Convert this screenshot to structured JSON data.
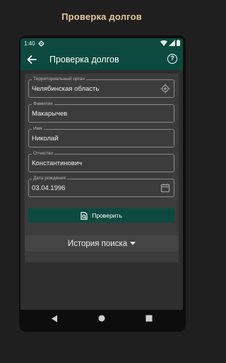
{
  "promo": {
    "title": "Проверка долгов"
  },
  "status_bar": {
    "time": "1:40",
    "icons": [
      "gear-icon",
      "wifi-icon",
      "signal-icon",
      "battery-icon"
    ]
  },
  "app_bar": {
    "title": "Проверка долгов",
    "back_icon": "arrow-back-icon",
    "help_icon": "help-icon",
    "help_glyph": "?"
  },
  "form": {
    "region": {
      "label": "Территориальный орган",
      "value": "Челябинская область",
      "icon": "location-icon"
    },
    "last_name": {
      "label": "Фамилия",
      "value": "Макарычев"
    },
    "first_name": {
      "label": "Имя",
      "value": "Николай"
    },
    "patronymic": {
      "label": "Отчество",
      "value": "Константинович"
    },
    "birth_date": {
      "label": "Дата рождения",
      "value": "03.04.1996",
      "icon": "calendar-icon"
    },
    "submit_label": "Проверить",
    "submit_icon": "document-search-icon"
  },
  "history": {
    "label": "История поиска",
    "icon": "caret-down-icon"
  },
  "nav": {
    "icons": [
      "back-triangle-icon",
      "home-circle-icon",
      "recents-square-icon"
    ]
  },
  "colors": {
    "primary": "#0c4a40",
    "background": "#1f1f1f",
    "promo_title": "#e8c79c"
  }
}
